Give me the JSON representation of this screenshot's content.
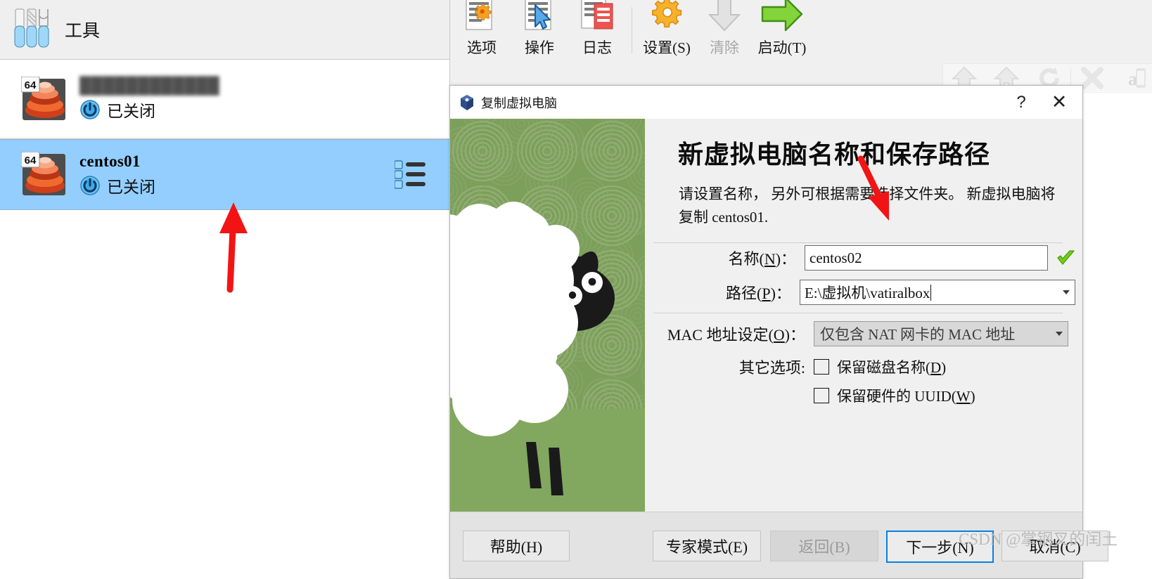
{
  "app": {
    "vm_list": {
      "tools_label": "工具",
      "machines": [
        {
          "name": "████████████",
          "state": "已关闭",
          "arch_badge": "64",
          "blurred": true,
          "selected": false
        },
        {
          "name": "centos01",
          "state": "已关闭",
          "arch_badge": "64",
          "blurred": false,
          "selected": true
        }
      ]
    },
    "toolbar": {
      "items": [
        {
          "label": "选项",
          "icon": "options-gear-document-icon",
          "disabled": false
        },
        {
          "label": "操作",
          "icon": "activity-cursor-document-icon",
          "disabled": false
        },
        {
          "label": "日志",
          "icon": "log-document-icon",
          "disabled": false
        },
        {
          "label": "设置(S)",
          "icon": "settings-gear-icon",
          "disabled": false
        },
        {
          "label": "清除",
          "icon": "discard-down-arrow-icon",
          "disabled": true
        },
        {
          "label": "启动(T)",
          "icon": "start-green-arrow-icon",
          "disabled": false
        }
      ],
      "overflow_label": "»"
    }
  },
  "dialog": {
    "title": "复制虚拟电脑",
    "help_glyph": "?",
    "close_glyph": "✕",
    "heading": "新虚拟电脑名称和保存路径",
    "description": "请设置名称， 另外可根据需要选择文件夹。 新虚拟电脑将复制 centos01.",
    "fields": {
      "name": {
        "label": "名称(N)",
        "accel": "N",
        "value": "centos02",
        "valid": true
      },
      "path": {
        "label": "路径(P)",
        "accel": "P",
        "value": "E:\\虚拟机\\vatiralbox"
      },
      "mac": {
        "label": "MAC 地址设定(O)",
        "accel": "O",
        "value": "仅包含 NAT 网卡的 MAC 地址"
      },
      "other": {
        "label": "其它选项:",
        "checkboxes": [
          {
            "label": "保留磁盘名称(D)",
            "accel": "D",
            "checked": false
          },
          {
            "label": "保留硬件的 UUID(W)",
            "accel": "W",
            "checked": false
          }
        ]
      }
    },
    "buttons": [
      {
        "id": "help",
        "label": "帮助(H)",
        "state": "normal"
      },
      {
        "id": "expert",
        "label": "专家模式(E)",
        "state": "normal"
      },
      {
        "id": "back",
        "label": "返回(B)",
        "state": "disabled"
      },
      {
        "id": "next",
        "label": "下一步(N)",
        "state": "default"
      },
      {
        "id": "cancel",
        "label": "取消(C)",
        "state": "normal"
      }
    ]
  },
  "watermark": "CSDN @掌钢叉的闰土",
  "colors": {
    "selection_blue": "#93ceff",
    "accent_blue": "#0a7fe0",
    "annotation_red": "#f21414",
    "sheep_green": "#7d9f5c",
    "valid_green": "#63c41a"
  }
}
